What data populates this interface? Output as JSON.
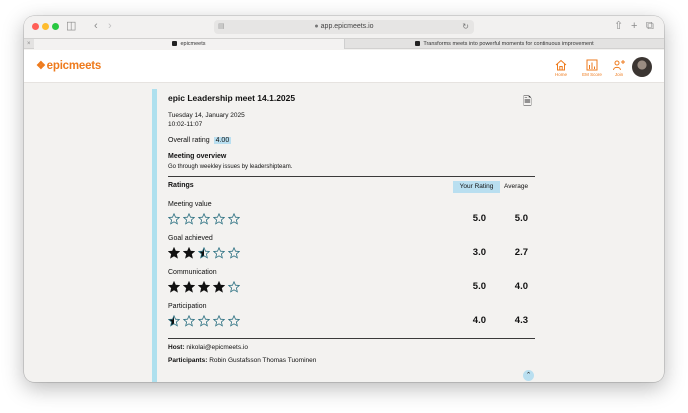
{
  "browser": {
    "url": "app.epicmeets.io",
    "tabs": [
      {
        "label": "epicmeets"
      },
      {
        "label": "Transforms meets into powerful moments for continuous improvement"
      }
    ]
  },
  "app": {
    "logo_text": "epicmeets",
    "brand_color": "#ee7a1c",
    "nav": [
      {
        "label": "Home",
        "icon": "home-icon"
      },
      {
        "label": "EM Score",
        "icon": "chart-icon"
      },
      {
        "label": "Join",
        "icon": "join-icon"
      }
    ]
  },
  "meeting": {
    "title": "epic Leadership meet 14.1.2025",
    "date": "Tuesday 14, January 2025",
    "time": "10:02-11:07",
    "overall_label": "Overall rating",
    "overall_value": "4.00",
    "overview_heading": "Meeting overview",
    "overview_text": "Go through weekley issues by leadershipteam."
  },
  "ratings": {
    "heading": "Ratings",
    "your_rating_label": "Your Rating",
    "average_label": "Average",
    "items": [
      {
        "label": "Meeting value",
        "stars_filled": 0,
        "stars_half": 0,
        "your": "5.0",
        "avg": "5.0"
      },
      {
        "label": "Goal achieved",
        "stars_filled": 2,
        "stars_half": 1,
        "your": "3.0",
        "avg": "2.7"
      },
      {
        "label": "Communication",
        "stars_filled": 4,
        "stars_half": 0,
        "your": "5.0",
        "avg": "4.0"
      },
      {
        "label": "Participation",
        "stars_filled": 0,
        "stars_half": 1,
        "your": "4.0",
        "avg": "4.3"
      }
    ]
  },
  "footer": {
    "host_label": "Host:",
    "host_value": "nikolai@epicmeets.io",
    "participants_label": "Participants:",
    "participants_value": "Robin Gustafsson Thomas Tuominen"
  }
}
